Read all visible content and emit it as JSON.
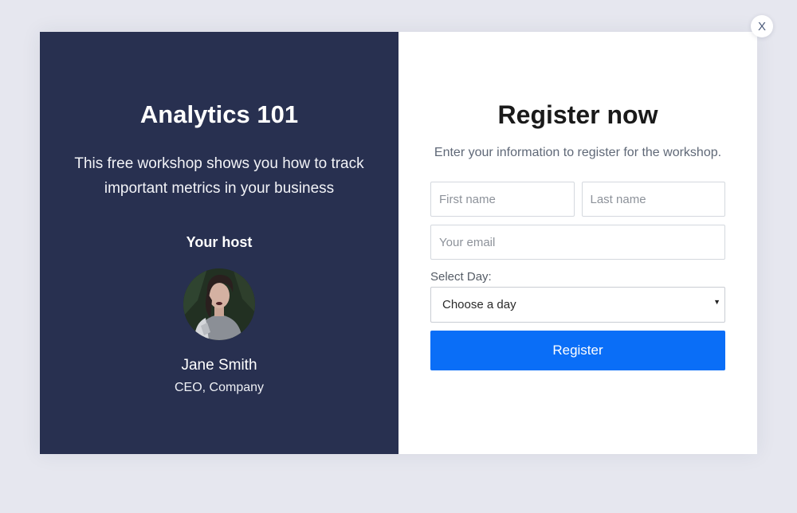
{
  "event": {
    "title": "Analytics 101",
    "description": "This free workshop shows you how to track important metrics in your business",
    "host_heading": "Your host",
    "host_name": "Jane Smith",
    "host_role": "CEO, Company"
  },
  "form": {
    "title": "Register now",
    "subtitle": "Enter your information to register for the workshop.",
    "first_name_placeholder": "First name",
    "last_name_placeholder": "Last name",
    "email_placeholder": "Your email",
    "select_label": "Select Day:",
    "select_value": "Choose a day",
    "submit_label": "Register"
  },
  "close_label": "X",
  "colors": {
    "panel_dark": "#283050",
    "accent": "#0a6ef7",
    "background": "#e6e7ef"
  }
}
